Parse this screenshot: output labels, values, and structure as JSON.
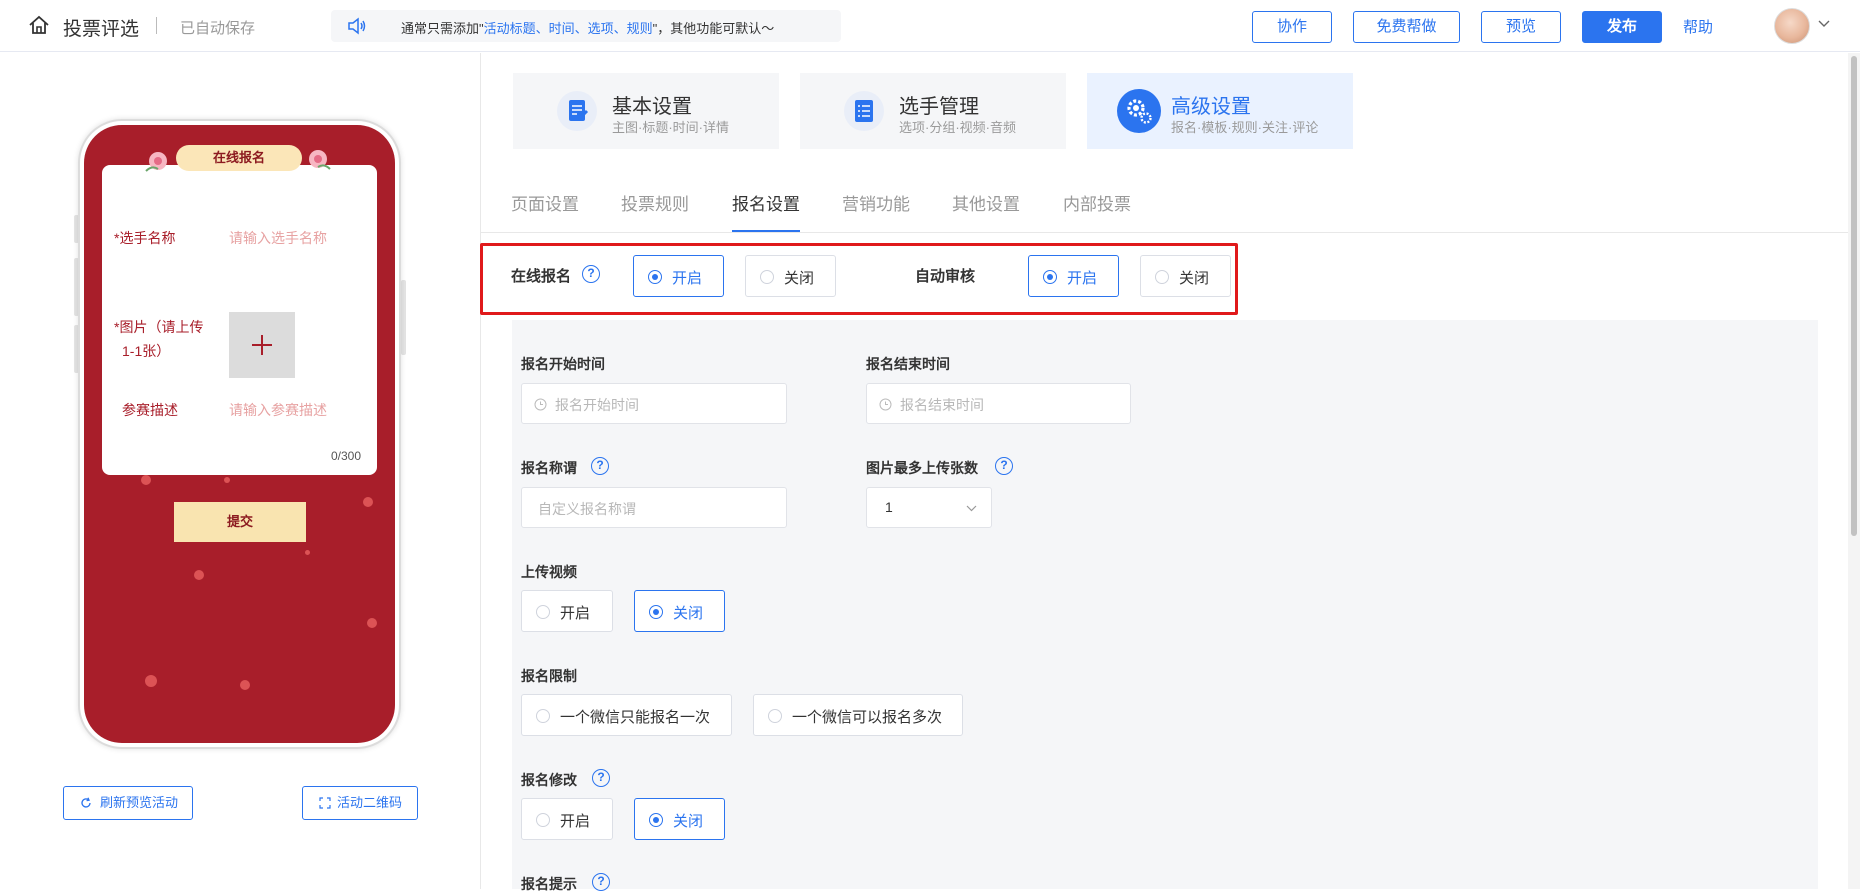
{
  "header": {
    "app_title": "投票评选",
    "autosave": "已自动保存",
    "notice": {
      "prefix": "通常只需添加\"",
      "highlight": "活动标题、时间、选项、规则",
      "suffix": "\"，其他功能可默认～"
    },
    "buttons": {
      "collaborate": "协作",
      "free_help": "免费帮做",
      "preview": "预览",
      "publish": "发布"
    },
    "help": "帮助",
    "colors": {
      "accent": "#2b74ef"
    }
  },
  "preview": {
    "banner_title": "在线报名",
    "fields": [
      {
        "label": "选手名称",
        "required": "*",
        "placeholder": "请输入选手名称"
      },
      {
        "label": "图片（请上传1-1张）",
        "line1": "图片（请上传",
        "line2": "1-1张）",
        "required": "*"
      },
      {
        "label": "参赛描述",
        "placeholder": "请输入参赛描述"
      }
    ],
    "counter": "0/300",
    "submit": "提交",
    "refresh_button": "刷新预览活动",
    "qrcode_button": "活动二维码",
    "colors": {
      "screen_bg": "#a81e2a"
    }
  },
  "steps": [
    {
      "title": "基本设置",
      "subtitle": "主图·标题·时间·详情",
      "icon": "edit-doc-icon"
    },
    {
      "title": "选手管理",
      "subtitle": "选项·分组·视频·音频",
      "icon": "list-icon"
    },
    {
      "title": "高级设置",
      "subtitle": "报名·模板·规则·关注·评论",
      "icon": "gears-icon"
    }
  ],
  "tabs": [
    "页面设置",
    "投票规则",
    "报名设置",
    "营销功能",
    "其他设置",
    "内部投票"
  ],
  "active_tab": "报名设置",
  "online_signup": {
    "label": "在线报名",
    "help": "?",
    "on": "开启",
    "off": "关闭",
    "selected": "开启"
  },
  "auto_review": {
    "label": "自动审核",
    "on": "开启",
    "off": "关闭",
    "selected": "开启"
  },
  "signup_start": {
    "label": "报名开始时间",
    "placeholder": "报名开始时间"
  },
  "signup_end": {
    "label": "报名结束时间",
    "placeholder": "报名结束时间"
  },
  "signup_title": {
    "label": "报名称谓",
    "help": "?",
    "placeholder": "自定义报名称谓"
  },
  "max_images": {
    "label": "图片最多上传张数",
    "help": "?",
    "value": "1"
  },
  "upload_video": {
    "label": "上传视频",
    "on": "开启",
    "off": "关闭",
    "selected": "关闭"
  },
  "signup_limit": {
    "label": "报名限制",
    "once": "一个微信只能报名一次",
    "multiple": "一个微信可以报名多次"
  },
  "signup_edit": {
    "label": "报名修改",
    "help": "?",
    "on": "开启",
    "off": "关闭",
    "selected": "关闭"
  },
  "signup_tip": {
    "label": "报名提示",
    "help": "?"
  }
}
